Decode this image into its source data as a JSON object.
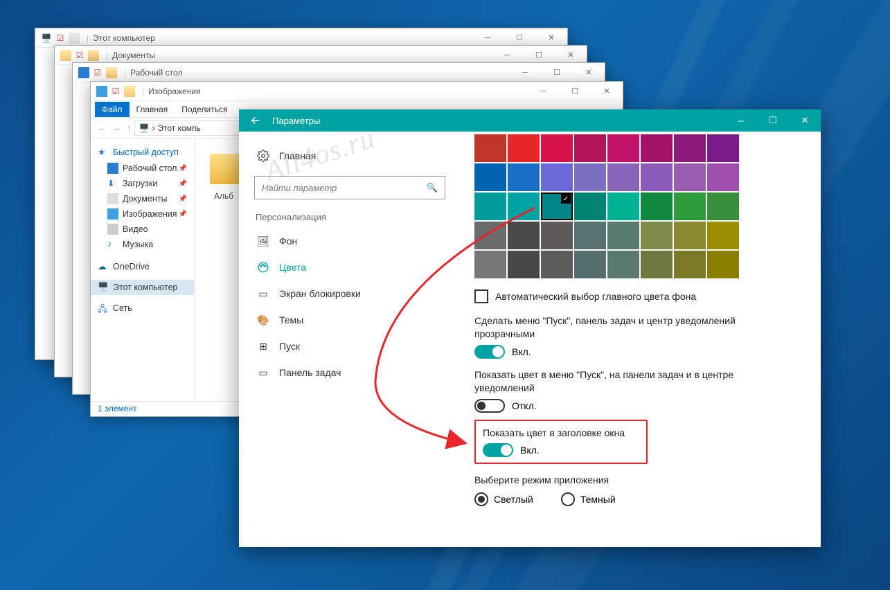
{
  "windows": {
    "w1": {
      "title": "Этот компьютер"
    },
    "w2": {
      "title": "Документы"
    },
    "w3": {
      "title": "Рабочий стол"
    },
    "w4": {
      "title": "Изображения",
      "tabs": {
        "file": "Файл",
        "home": "Главная",
        "share": "Поделиться"
      },
      "crumb": "Этот компь",
      "side": {
        "quick": "Быстрый доступ",
        "desktop": "Рабочий стол",
        "downloads": "Загрузки",
        "documents": "Документы",
        "pictures": "Изображения",
        "video": "Видео",
        "music": "Музыка",
        "onedrive": "OneDrive",
        "thispc": "Этот компьютер",
        "network": "Сеть"
      },
      "content_label": "Альб",
      "status": "1 элемент"
    }
  },
  "settings": {
    "title": "Параметры",
    "home": "Главная",
    "search_placeholder": "Найти параметр",
    "section": "Персонализация",
    "nav": {
      "background": "Фон",
      "colors": "Цвета",
      "lockscreen": "Экран блокировки",
      "themes": "Темы",
      "start": "Пуск",
      "taskbar": "Панель задач"
    },
    "auto_color": "Автоматический выбор главного цвета фона",
    "opt1": "Сделать меню \"Пуск\", панель задач и центр уведомлений прозрачными",
    "opt2": "Показать цвет в меню \"Пуск\", на панели задач и в центре уведомлений",
    "opt3": "Показать цвет в заголовке окна",
    "on": "Вкл.",
    "off": "Откл.",
    "app_mode": "Выберите режим приложения",
    "light": "Светлый",
    "dark": "Темный",
    "palette": [
      [
        "#c0352a",
        "#e8262a",
        "#d4144a",
        "#b01657",
        "#c3126a",
        "#a11269",
        "#8b1a7a",
        "#7a1b88"
      ],
      [
        "#0063b1",
        "#1a6fc4",
        "#6b69d6",
        "#7b6fc4",
        "#8764b8",
        "#8a5cb8",
        "#9c5cb0",
        "#a04fb0"
      ],
      [
        "#009b9b",
        "#00a3a3",
        "#038387",
        "#008272",
        "#00b294",
        "#10893e",
        "#2d9c3c",
        "#3a8f3a"
      ],
      [
        "#6b6b6b",
        "#4c4a48",
        "#5d5a58",
        "#577171",
        "#577c6e",
        "#7d8a4a",
        "#8a8a2e",
        "#9a8f00"
      ],
      [
        "#767676",
        "#4a4846",
        "#5e5c5a",
        "#546e6e",
        "#5a7a6e",
        "#6c7a3f",
        "#7a7a28",
        "#8a7f00"
      ]
    ],
    "selected_swatch": {
      "row": 2,
      "col": 2
    }
  },
  "watermark": "All4os.ru"
}
